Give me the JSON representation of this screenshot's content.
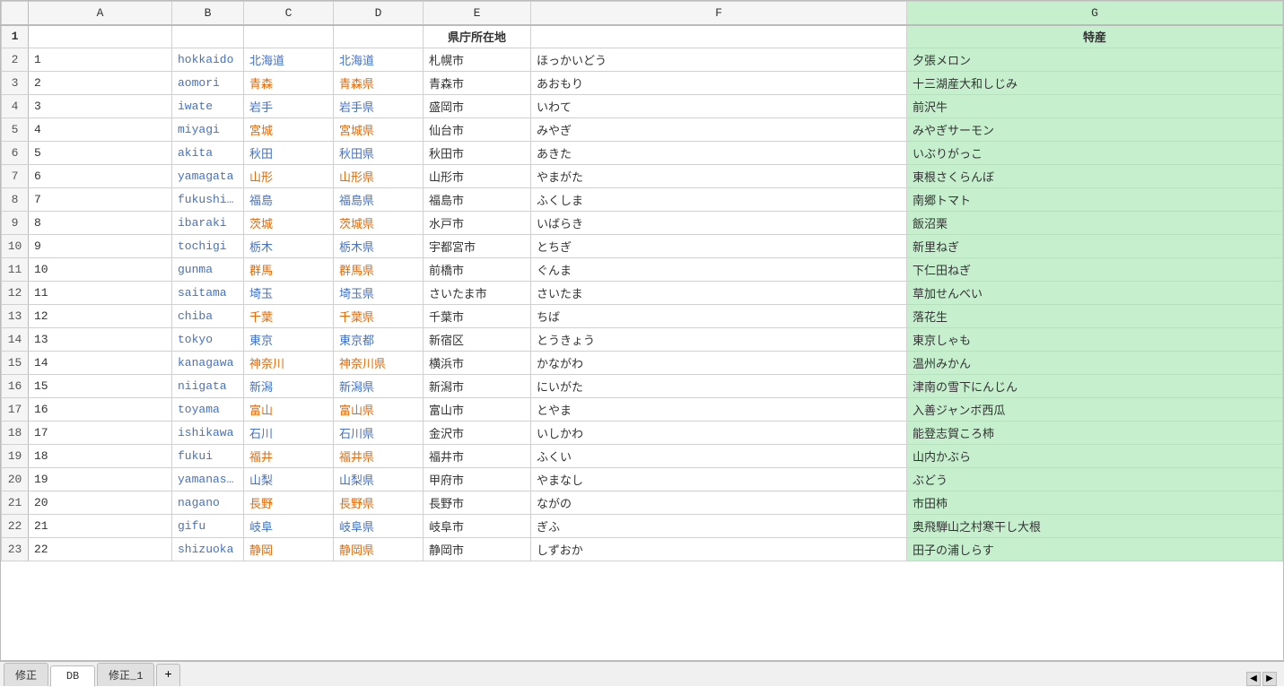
{
  "title": "Spreadsheet",
  "tabs": [
    {
      "label": "修正",
      "active": false
    },
    {
      "label": "DB",
      "active": true
    },
    {
      "label": "修正_1",
      "active": false
    }
  ],
  "columns": {
    "row_num": "",
    "a": "A",
    "b": "B",
    "c": "C",
    "d": "D",
    "e": "E",
    "f": "F",
    "g": "G"
  },
  "header_row": {
    "row": "1",
    "a": "",
    "b": "",
    "c": "",
    "d": "",
    "e": "県庁所在地",
    "f": "",
    "g": "特産"
  },
  "rows": [
    {
      "row": "2",
      "a": "1",
      "b": "hokkaido",
      "c": "北海道",
      "d": "北海道",
      "e": "札幌市",
      "f": "ほっかいどう",
      "g": "夕張メロン"
    },
    {
      "row": "3",
      "a": "2",
      "b": "aomori",
      "c": "青森",
      "d": "青森県",
      "e": "青森市",
      "f": "あおもり",
      "g": "十三湖産大和しじみ"
    },
    {
      "row": "4",
      "a": "3",
      "b": "iwate",
      "c": "岩手",
      "d": "岩手県",
      "e": "盛岡市",
      "f": "いわて",
      "g": "前沢牛"
    },
    {
      "row": "5",
      "a": "4",
      "b": "miyagi",
      "c": "宮城",
      "d": "宮城県",
      "e": "仙台市",
      "f": "みやぎ",
      "g": "みやぎサーモン"
    },
    {
      "row": "6",
      "a": "5",
      "b": "akita",
      "c": "秋田",
      "d": "秋田県",
      "e": "秋田市",
      "f": "あきた",
      "g": "いぶりがっこ"
    },
    {
      "row": "7",
      "a": "6",
      "b": "yamagata",
      "c": "山形",
      "d": "山形県",
      "e": "山形市",
      "f": "やまがた",
      "g": "東根さくらんぼ"
    },
    {
      "row": "8",
      "a": "7",
      "b": "fukushima",
      "c": "福島",
      "d": "福島県",
      "e": "福島市",
      "f": "ふくしま",
      "g": "南郷トマト"
    },
    {
      "row": "9",
      "a": "8",
      "b": "ibaraki",
      "c": "茨城",
      "d": "茨城県",
      "e": "水戸市",
      "f": "いばらき",
      "g": "飯沼栗"
    },
    {
      "row": "10",
      "a": "9",
      "b": "tochigi",
      "c": "栃木",
      "d": "栃木県",
      "e": "宇都宮市",
      "f": "とちぎ",
      "g": "新里ねぎ"
    },
    {
      "row": "11",
      "a": "10",
      "b": "gunma",
      "c": "群馬",
      "d": "群馬県",
      "e": "前橋市",
      "f": "ぐんま",
      "g": "下仁田ねぎ"
    },
    {
      "row": "12",
      "a": "11",
      "b": "saitama",
      "c": "埼玉",
      "d": "埼玉県",
      "e": "さいたま市",
      "f": "さいたま",
      "g": "草加せんべい"
    },
    {
      "row": "13",
      "a": "12",
      "b": "chiba",
      "c": "千葉",
      "d": "千葉県",
      "e": "千葉市",
      "f": "ちば",
      "g": "落花生"
    },
    {
      "row": "14",
      "a": "13",
      "b": "tokyo",
      "c": "東京",
      "d": "東京都",
      "e": "新宿区",
      "f": "とうきょう",
      "g": "東京しゃも"
    },
    {
      "row": "15",
      "a": "14",
      "b": "kanagawa",
      "c": "神奈川",
      "d": "神奈川県",
      "e": "横浜市",
      "f": "かながわ",
      "g": "温州みかん"
    },
    {
      "row": "16",
      "a": "15",
      "b": "niigata",
      "c": "新潟",
      "d": "新潟県",
      "e": "新潟市",
      "f": "にいがた",
      "g": "津南の雪下にんじん"
    },
    {
      "row": "17",
      "a": "16",
      "b": "toyama",
      "c": "富山",
      "d": "富山県",
      "e": "富山市",
      "f": "とやま",
      "g": "入善ジャンボ西瓜"
    },
    {
      "row": "18",
      "a": "17",
      "b": "ishikawa",
      "c": "石川",
      "d": "石川県",
      "e": "金沢市",
      "f": "いしかわ",
      "g": "能登志賀ころ柿"
    },
    {
      "row": "19",
      "a": "18",
      "b": "fukui",
      "c": "福井",
      "d": "福井県",
      "e": "福井市",
      "f": "ふくい",
      "g": "山内かぶら"
    },
    {
      "row": "20",
      "a": "19",
      "b": "yamanashi",
      "c": "山梨",
      "d": "山梨県",
      "e": "甲府市",
      "f": "やまなし",
      "g": "ぶどう"
    },
    {
      "row": "21",
      "a": "20",
      "b": "nagano",
      "c": "長野",
      "d": "長野県",
      "e": "長野市",
      "f": "ながの",
      "g": "市田柿"
    },
    {
      "row": "22",
      "a": "21",
      "b": "gifu",
      "c": "岐阜",
      "d": "岐阜県",
      "e": "岐阜市",
      "f": "ぎふ",
      "g": "奥飛騨山之村寒干し大根"
    },
    {
      "row": "23",
      "a": "22",
      "b": "shizuoka",
      "c": "静岡",
      "d": "静岡県",
      "e": "静岡市",
      "f": "しずおか",
      "g": "田子の浦しらす"
    }
  ]
}
